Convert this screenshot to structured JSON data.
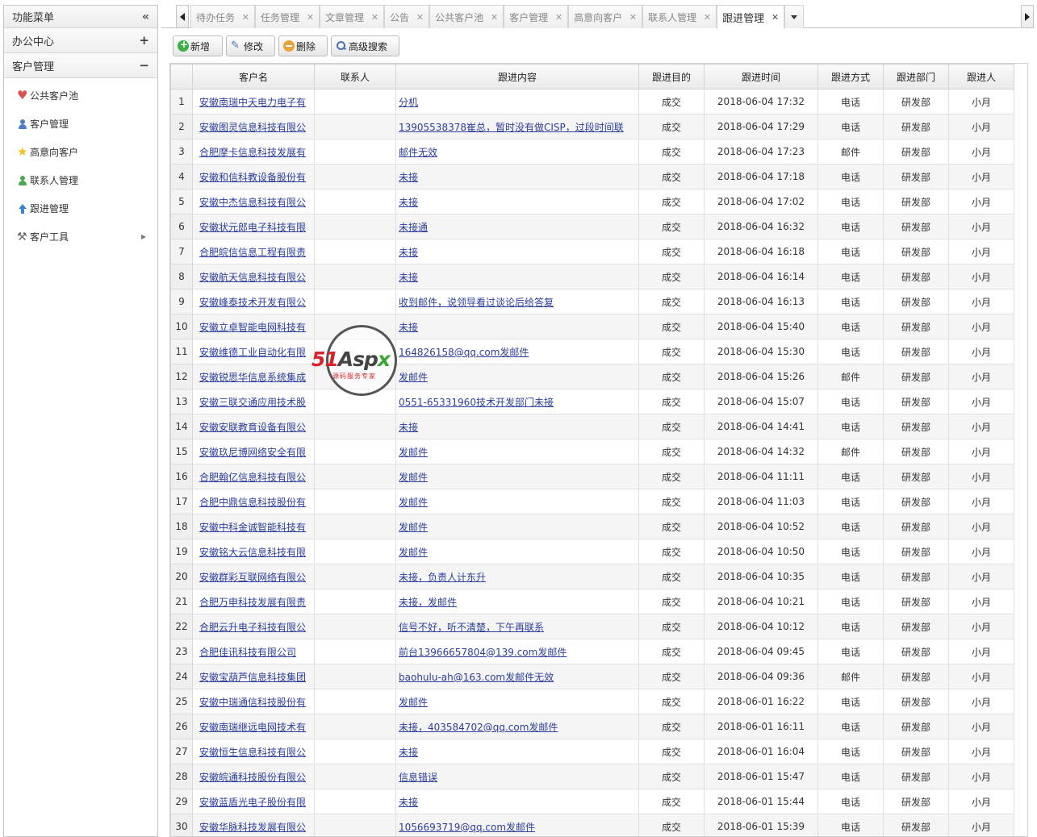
{
  "sidebar": {
    "title": "功能菜单",
    "collapse_glyph": "«",
    "panels": [
      {
        "label": "办公中心",
        "toggle": "+"
      },
      {
        "label": "客户管理",
        "toggle": "−"
      }
    ],
    "items": [
      {
        "label": "公共客户池",
        "icon": "heart-icon"
      },
      {
        "label": "客户管理",
        "icon": "user-icon"
      },
      {
        "label": "高意向客户",
        "icon": "star-icon"
      },
      {
        "label": "联系人管理",
        "icon": "user-icon"
      },
      {
        "label": "跟进管理",
        "icon": "up-arrow-icon"
      },
      {
        "label": "客户工具",
        "icon": "tools-icon"
      }
    ]
  },
  "tabs": [
    {
      "label": "待办任务"
    },
    {
      "label": "任务管理"
    },
    {
      "label": "文章管理"
    },
    {
      "label": "公告"
    },
    {
      "label": "公共客户池"
    },
    {
      "label": "客户管理"
    },
    {
      "label": "高意向客户"
    },
    {
      "label": "联系人管理"
    },
    {
      "label": "跟进管理",
      "active": true
    }
  ],
  "toolbar": {
    "add_label": "新增",
    "edit_label": "修改",
    "delete_label": "删除",
    "search_label": "高级搜索"
  },
  "grid": {
    "columns": [
      "客户名",
      "联系人",
      "跟进内容",
      "跟进目的",
      "跟进时间",
      "跟进方式",
      "跟进部门",
      "跟进人"
    ],
    "rows": [
      [
        "1",
        "安徽南瑞中天电力电子有",
        "",
        "分机",
        "成交",
        "2018-06-04 17:32",
        "电话",
        "研发部",
        "小月"
      ],
      [
        "2",
        "安徽图灵信息科技有限公",
        "",
        "13905538378崔总，暂时没有做CISP，过段时间联",
        "成交",
        "2018-06-04 17:29",
        "电话",
        "研发部",
        "小月"
      ],
      [
        "3",
        "合肥摩卡信息科技发展有",
        "",
        "邮件无效",
        "成交",
        "2018-06-04 17:23",
        "邮件",
        "研发部",
        "小月"
      ],
      [
        "4",
        "安徽和信科教设备股份有",
        "",
        "未接",
        "成交",
        "2018-06-04 17:18",
        "电话",
        "研发部",
        "小月"
      ],
      [
        "5",
        "安徽中杰信息科技有限公",
        "",
        "未接",
        "成交",
        "2018-06-04 17:02",
        "电话",
        "研发部",
        "小月"
      ],
      [
        "6",
        "安徽状元郎电子科技有限",
        "",
        "未接通",
        "成交",
        "2018-06-04 16:32",
        "电话",
        "研发部",
        "小月"
      ],
      [
        "7",
        "合肥皖信信息工程有限责",
        "",
        "未接",
        "成交",
        "2018-06-04 16:18",
        "电话",
        "研发部",
        "小月"
      ],
      [
        "8",
        "安徽航天信息科技有限公",
        "",
        "未接",
        "成交",
        "2018-06-04 16:14",
        "电话",
        "研发部",
        "小月"
      ],
      [
        "9",
        "安徽峰泰技术开发有限公",
        "",
        "收到邮件，说领导看过谈论后给答复",
        "成交",
        "2018-06-04 16:13",
        "电话",
        "研发部",
        "小月"
      ],
      [
        "10",
        "安徽立卓智能电网科技有",
        "",
        "未接",
        "成交",
        "2018-06-04 15:40",
        "电话",
        "研发部",
        "小月"
      ],
      [
        "11",
        "安徽维德工业自动化有限",
        "",
        "164826158@qq.com发邮件",
        "成交",
        "2018-06-04 15:30",
        "电话",
        "研发部",
        "小月"
      ],
      [
        "12",
        "安徽锐思华信息系统集成",
        "",
        "发邮件",
        "成交",
        "2018-06-04 15:26",
        "邮件",
        "研发部",
        "小月"
      ],
      [
        "13",
        "安徽三联交通应用技术股",
        "",
        "0551-65331960技术开发部门未接",
        "成交",
        "2018-06-04 15:07",
        "电话",
        "研发部",
        "小月"
      ],
      [
        "14",
        "安徽安联教育设备有限公",
        "",
        "未接",
        "成交",
        "2018-06-04 14:41",
        "电话",
        "研发部",
        "小月"
      ],
      [
        "15",
        "安徽玖尼博网络安全有限",
        "",
        "发邮件",
        "成交",
        "2018-06-04 14:32",
        "邮件",
        "研发部",
        "小月"
      ],
      [
        "16",
        "合肥翰亿信息科技有限公",
        "",
        "发邮件",
        "成交",
        "2018-06-04 11:11",
        "电话",
        "研发部",
        "小月"
      ],
      [
        "17",
        "合肥中鼎信息科技股份有",
        "",
        "发邮件",
        "成交",
        "2018-06-04 11:03",
        "电话",
        "研发部",
        "小月"
      ],
      [
        "18",
        "安徽中科金诚智能科技有",
        "",
        "发邮件",
        "成交",
        "2018-06-04 10:52",
        "电话",
        "研发部",
        "小月"
      ],
      [
        "19",
        "安徽铭大云信息科技有限",
        "",
        "发邮件",
        "成交",
        "2018-06-04 10:50",
        "电话",
        "研发部",
        "小月"
      ],
      [
        "20",
        "安徽群彩互联网络有限公",
        "",
        "未接，负责人计东升",
        "成交",
        "2018-06-04 10:35",
        "电话",
        "研发部",
        "小月"
      ],
      [
        "21",
        "合肥万申科技发展有限责",
        "",
        "未接，发邮件",
        "成交",
        "2018-06-04 10:21",
        "电话",
        "研发部",
        "小月"
      ],
      [
        "22",
        "合肥云升电子科技有限公",
        "",
        "信号不好，听不清楚，下午再联系",
        "成交",
        "2018-06-04 10:12",
        "电话",
        "研发部",
        "小月"
      ],
      [
        "23",
        "合肥佳讯科技有限公司",
        "",
        "前台13966657804@139.com发邮件",
        "成交",
        "2018-06-04 09:45",
        "电话",
        "研发部",
        "小月"
      ],
      [
        "24",
        "安徽宝葫芦信息科技集团",
        "",
        "baohulu-ah@163.com发邮件无效",
        "成交",
        "2018-06-04 09:36",
        "邮件",
        "研发部",
        "小月"
      ],
      [
        "25",
        "安徽中瑞通信科技股份有",
        "",
        "发邮件",
        "成交",
        "2018-06-01 16:22",
        "电话",
        "研发部",
        "小月"
      ],
      [
        "26",
        "安徽南瑞继远电网技术有",
        "",
        "未接，403584702@qq.com发邮件",
        "成交",
        "2018-06-01 16:11",
        "电话",
        "研发部",
        "小月"
      ],
      [
        "27",
        "安徽恒生信息科技有限公",
        "",
        "未接",
        "成交",
        "2018-06-01 16:04",
        "电话",
        "研发部",
        "小月"
      ],
      [
        "28",
        "安徽皖通科技股份有限公",
        "",
        "信息错误",
        "成交",
        "2018-06-01 15:47",
        "电话",
        "研发部",
        "小月"
      ],
      [
        "29",
        "安徽蓝盾光电子股份有限",
        "",
        "未接",
        "成交",
        "2018-06-01 15:44",
        "电话",
        "研发部",
        "小月"
      ],
      [
        "30",
        "安徽华脉科技发展有限公",
        "",
        "1056693719@qq.com发邮件",
        "成交",
        "2018-06-01 15:39",
        "电话",
        "研发部",
        "小月"
      ]
    ]
  },
  "watermark": {
    "brand_a": "51",
    "brand_b": "Asp",
    "brand_c": "x",
    "tagline": "源码服务专家"
  }
}
